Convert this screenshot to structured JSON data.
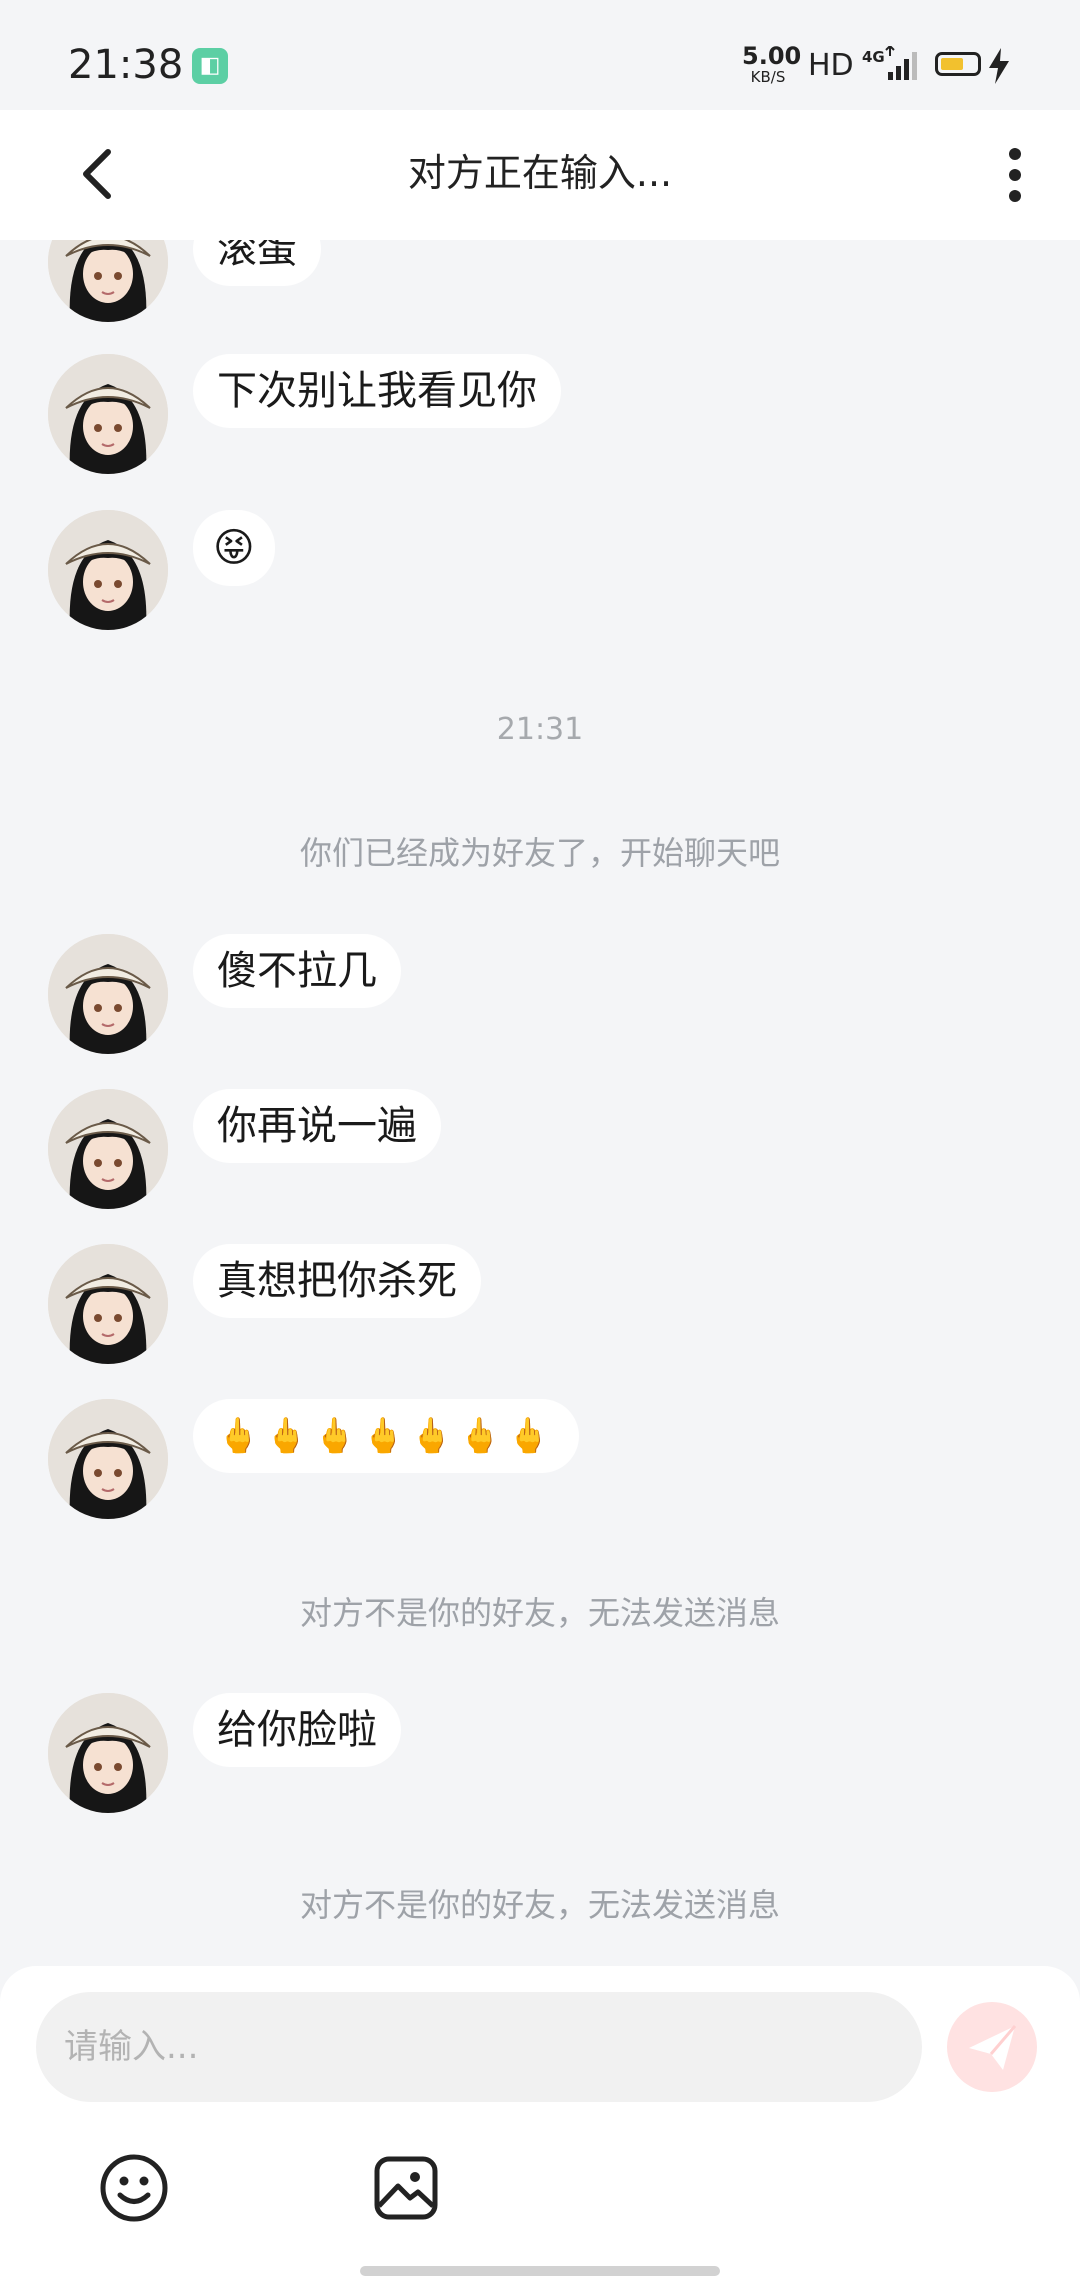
{
  "status_bar": {
    "time": "21:38",
    "net_speed": "5.00",
    "net_unit": "KB/S",
    "hd": "HD",
    "network": "4G",
    "battery_color": "#f2c12e"
  },
  "header": {
    "title": "对方正在输入..."
  },
  "messages": [
    {
      "text": "滚蛋"
    },
    {
      "text": "下次别让我看见你"
    },
    {
      "text": "😝"
    },
    {
      "text": "傻不拉几"
    },
    {
      "text": "你再说一遍"
    },
    {
      "text": "真想把你杀死"
    },
    {
      "text": "🖕🖕🖕🖕🖕🖕🖕"
    },
    {
      "text": "给你脸啦"
    }
  ],
  "timestamp": "21:31",
  "system_notices": {
    "friend_added": "你们已经成为好友了，开始聊天吧",
    "not_friend_1": "对方不是你的好友，无法发送消息",
    "not_friend_2": "对方不是你的好友，无法发送消息"
  },
  "composer": {
    "placeholder": "请输入...",
    "send_color": "#ff8a8a"
  },
  "icons": {
    "back": "chevron-left-icon",
    "more": "more-vertical-icon",
    "emoji": "smiley-icon",
    "image": "image-icon",
    "send": "paper-plane-icon"
  }
}
